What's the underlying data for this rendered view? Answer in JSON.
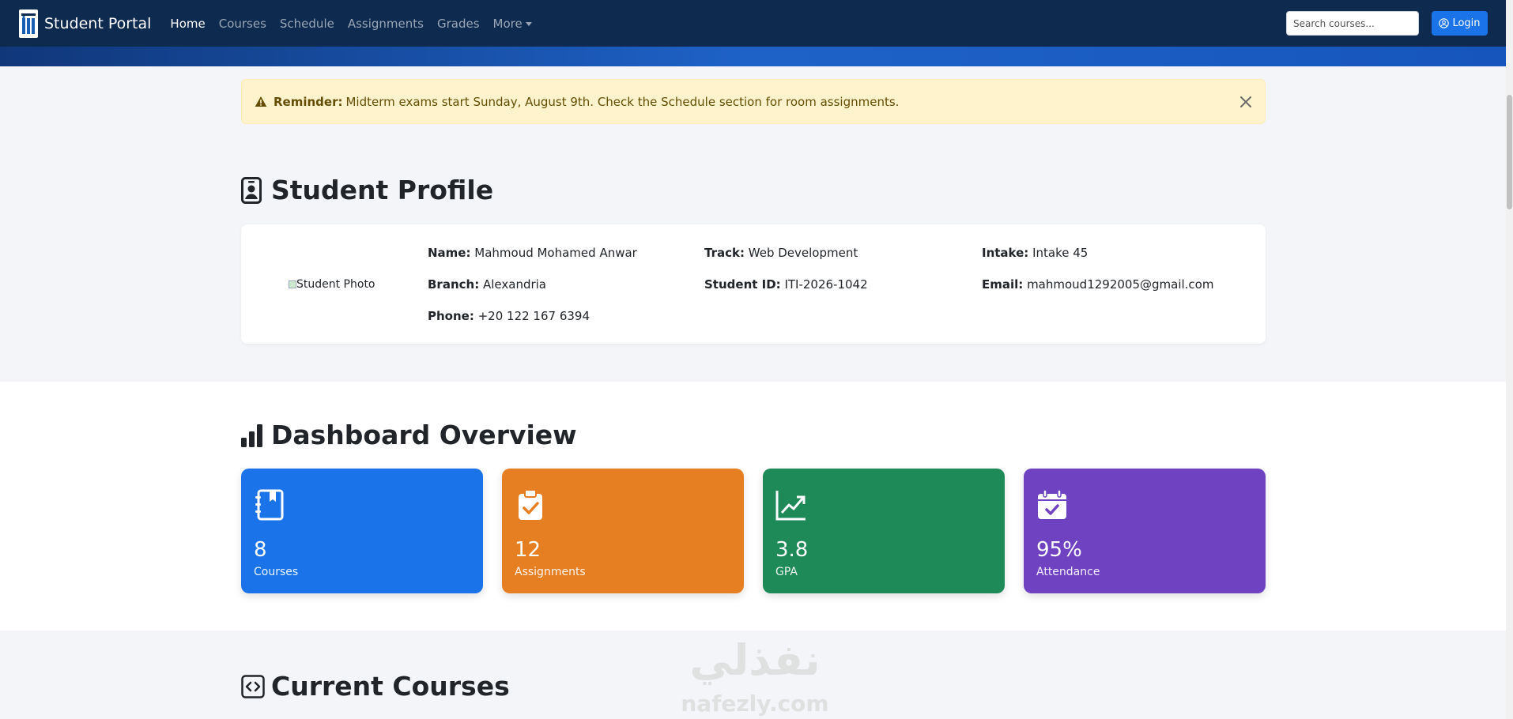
{
  "navbar": {
    "brand": "Student Portal",
    "links": [
      {
        "label": "Home",
        "active": true
      },
      {
        "label": "Courses",
        "active": false
      },
      {
        "label": "Schedule",
        "active": false
      },
      {
        "label": "Assignments",
        "active": false
      },
      {
        "label": "Grades",
        "active": false
      },
      {
        "label": "More",
        "active": false,
        "dropdown": true
      }
    ],
    "search_placeholder": "Search courses...",
    "login_label": "Login"
  },
  "alert": {
    "strong": "Reminder:",
    "message": "Midterm exams start Sunday, August 9th. Check the Schedule section for room assignments.",
    "icon": "warning-triangle-icon"
  },
  "profile": {
    "title": "Student Profile",
    "photo_alt": "Student Photo",
    "fields": {
      "name": {
        "label": "Name:",
        "value": "Mahmoud Mohamed Anwar"
      },
      "track": {
        "label": "Track:",
        "value": "Web Development"
      },
      "intake": {
        "label": "Intake:",
        "value": "Intake 45"
      },
      "branch": {
        "label": "Branch:",
        "value": "Alexandria"
      },
      "student_id": {
        "label": "Student ID:",
        "value": "ITI-2026-1042"
      },
      "email": {
        "label": "Email:",
        "value": "mahmoud1292005@gmail.com"
      },
      "phone": {
        "label": "Phone:",
        "value": "+20 122 167 6394"
      }
    }
  },
  "overview": {
    "title": "Dashboard Overview",
    "cards": [
      {
        "value": "8",
        "label": "Courses",
        "color": "#1a73e8",
        "icon": "journal-bookmark-icon"
      },
      {
        "value": "12",
        "label": "Assignments",
        "color": "#e67e22",
        "icon": "clipboard-check-icon"
      },
      {
        "value": "3.8",
        "label": "GPA",
        "color": "#1e8a57",
        "icon": "graph-up-icon"
      },
      {
        "value": "95%",
        "label": "Attendance",
        "color": "#6f42c1",
        "icon": "calendar-check-icon"
      }
    ]
  },
  "courses": {
    "title": "Current Courses"
  },
  "watermark": {
    "text_ar": "نفذلي",
    "text_en": "nafezly.com"
  },
  "colors": {
    "navbar_bg": "#0e2a4f",
    "primary": "#1a73e8",
    "alert_bg": "#fff3cd"
  }
}
